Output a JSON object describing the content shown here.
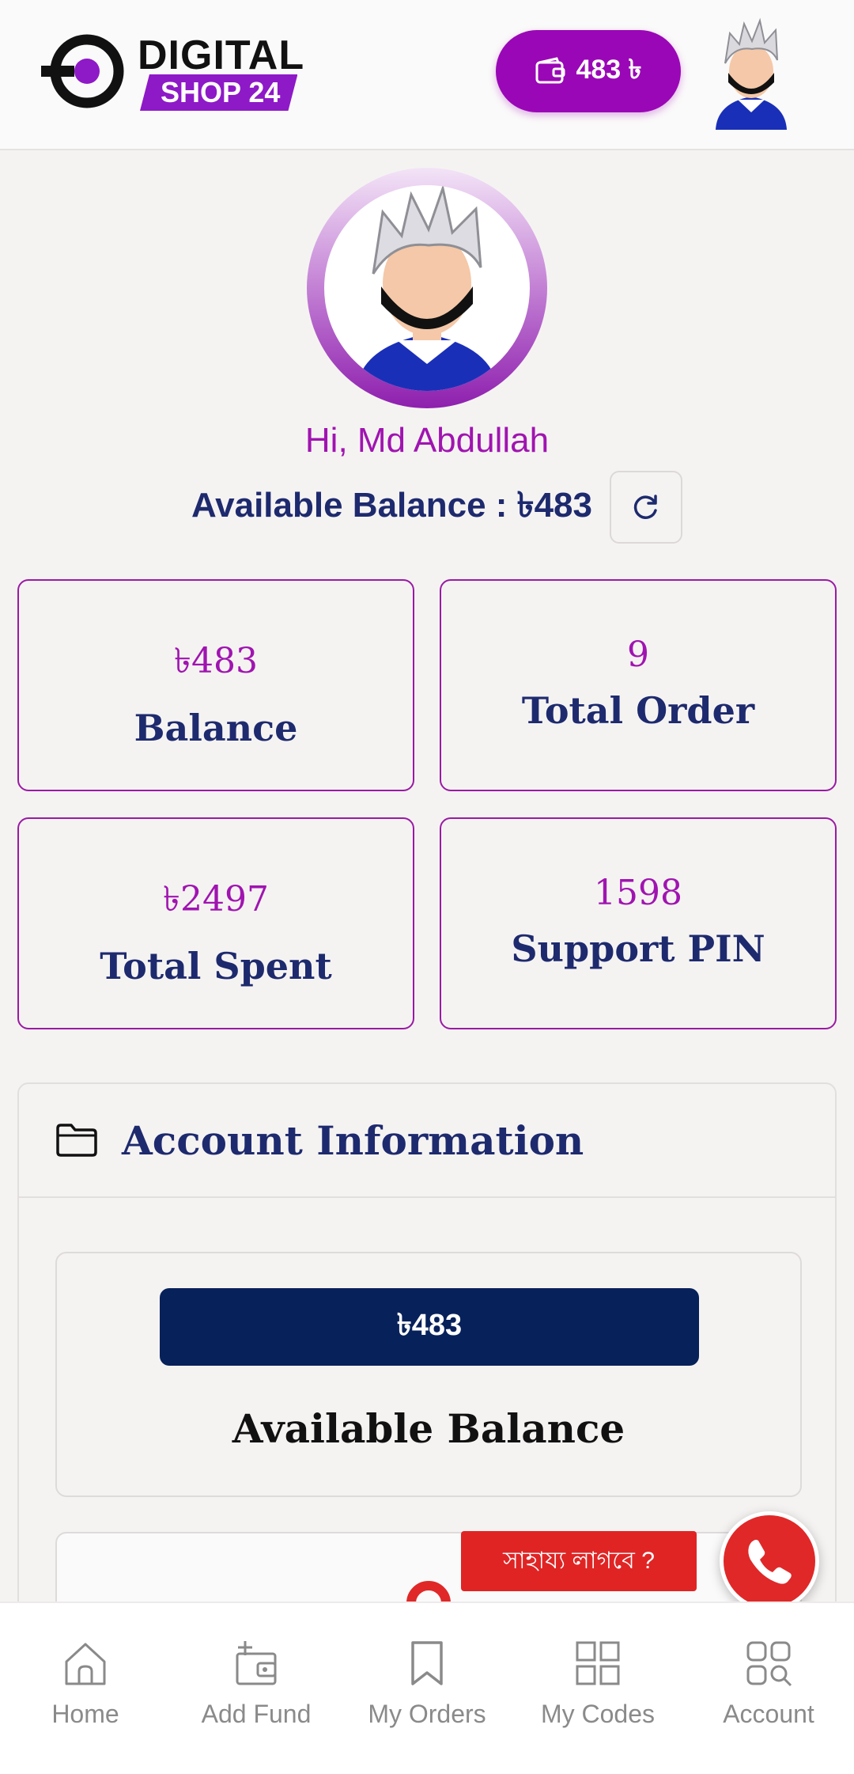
{
  "header": {
    "logo_line1": "DIGITAL",
    "logo_line2": "SHOP 24",
    "wallet_label": "483 ৳"
  },
  "profile": {
    "greeting": "Hi, Md Abdullah",
    "available_balance": "Available Balance : ৳483"
  },
  "stats": [
    {
      "value": "৳483",
      "label": "Balance"
    },
    {
      "value": "9",
      "label": "Total Order"
    },
    {
      "value": "৳2497",
      "label": "Total Spent"
    },
    {
      "value": "1598",
      "label": "Support PIN"
    }
  ],
  "account": {
    "title": "Account Information",
    "balance_value": "৳483",
    "balance_label": "Available Balance"
  },
  "help": {
    "label": "সাহায্য লাগবে ?"
  },
  "nav": [
    {
      "label": "Home",
      "icon": "home-icon"
    },
    {
      "label": "Add Fund",
      "icon": "add-fund-icon"
    },
    {
      "label": "My Orders",
      "icon": "bookmark-icon"
    },
    {
      "label": "My Codes",
      "icon": "grid-icon"
    },
    {
      "label": "Account",
      "icon": "account-grid-icon"
    }
  ],
  "colors": {
    "accent": "#9a07b6",
    "navy": "#1e2a6e",
    "dark_navy": "#07215a",
    "help_red": "#e02828"
  }
}
